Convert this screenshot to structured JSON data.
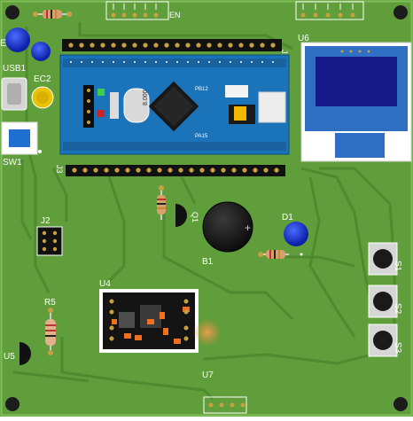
{
  "board": {
    "background": "#5f9e3a",
    "trace_color": "#4e8a2e",
    "silk_color": "#ffffff"
  },
  "labels": {
    "e": "E",
    "usb1": "USB1",
    "ec2": "EC2",
    "sw1": "SW1",
    "j1": "J1",
    "j2": "J2",
    "j3": "J3",
    "u6": "U6",
    "q1": "Q1",
    "b1": "B1",
    "d1": "D1",
    "u4": "U4",
    "r5": "R5",
    "u5": "U5",
    "u7": "U7",
    "s1": "S1",
    "s2": "S2",
    "s3": "S3",
    "en": "EN",
    "crystal": "8.000",
    "mcu_top": "PB12",
    "mcu_bottom": "PA15"
  }
}
